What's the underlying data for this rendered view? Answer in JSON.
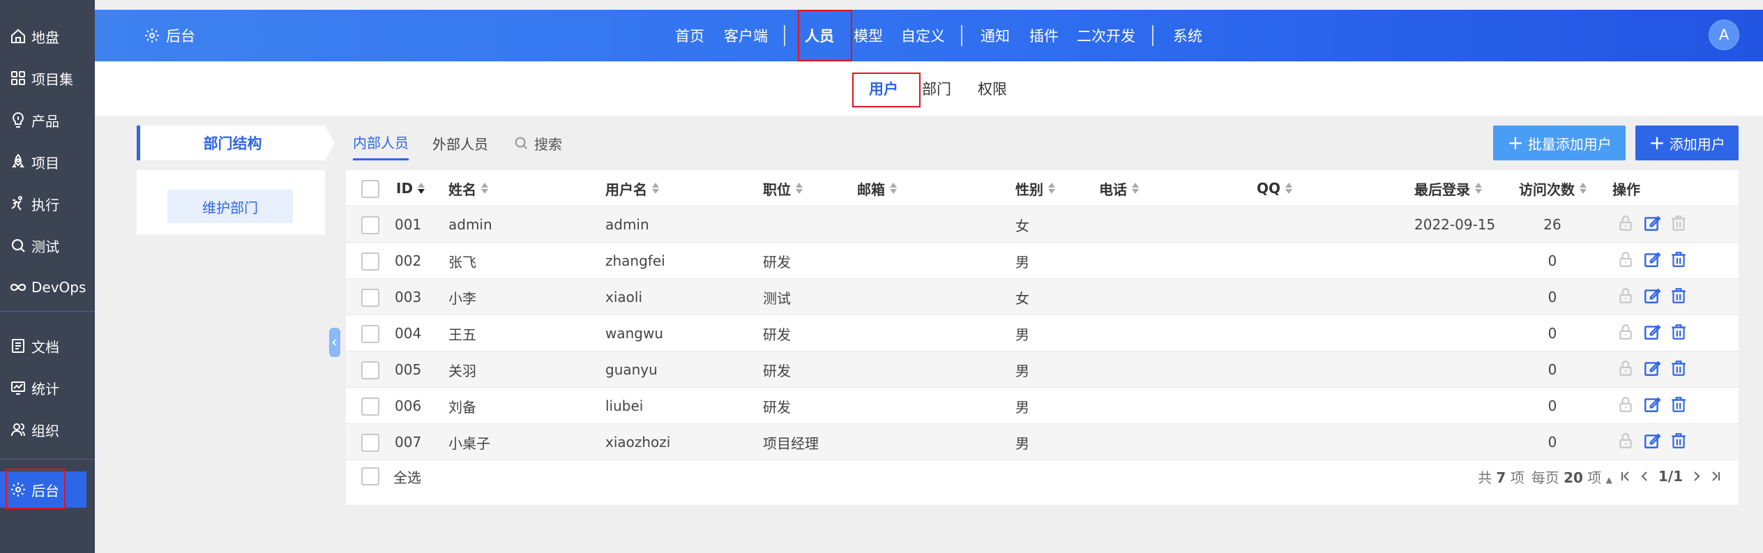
{
  "sidebar": {
    "items": [
      {
        "label": "地盘",
        "icon": "home-icon"
      },
      {
        "label": "项目集",
        "icon": "grid-icon"
      },
      {
        "label": "产品",
        "icon": "bulb-icon"
      },
      {
        "label": "项目",
        "icon": "rocket-icon"
      },
      {
        "label": "执行",
        "icon": "run-icon"
      },
      {
        "label": "测试",
        "icon": "search-icon"
      },
      {
        "label": "DevOps",
        "icon": "infinity-icon"
      },
      {
        "label": "文档",
        "icon": "doc-icon"
      },
      {
        "label": "统计",
        "icon": "chart-icon"
      },
      {
        "label": "组织",
        "icon": "people-icon"
      },
      {
        "label": "后台",
        "icon": "gear-icon",
        "active": true
      }
    ]
  },
  "header": {
    "brand": "后台",
    "nav": [
      "首页",
      "客户端",
      "人员",
      "模型",
      "自定义",
      "通知",
      "插件",
      "二次开发",
      "系统"
    ],
    "active_nav": "人员",
    "avatar_letter": "A"
  },
  "subnav": {
    "tabs": [
      "用户",
      "部门",
      "权限"
    ],
    "active": "用户"
  },
  "dept_panel": {
    "title": "部门结构",
    "maintain_button": "维护部门"
  },
  "user_tabs": {
    "internal": "内部人员",
    "external": "外部人员",
    "search": "搜索"
  },
  "actions": {
    "batch_add": "批量添加用户",
    "add": "添加用户"
  },
  "table": {
    "columns": {
      "id": "ID",
      "name": "姓名",
      "username": "用户名",
      "position": "职位",
      "email": "邮箱",
      "gender": "性别",
      "phone": "电话",
      "qq": "QQ",
      "last_login": "最后登录",
      "visits": "访问次数",
      "ops": "操作"
    },
    "rows": [
      {
        "id": "001",
        "name": "admin",
        "username": "admin",
        "position": "",
        "gender": "女",
        "last_login": "2022-09-15",
        "visits": "26"
      },
      {
        "id": "002",
        "name": "张飞",
        "username": "zhangfei",
        "position": "研发",
        "gender": "男",
        "last_login": "",
        "visits": "0"
      },
      {
        "id": "003",
        "name": "小李",
        "username": "xiaoli",
        "position": "测试",
        "gender": "女",
        "last_login": "",
        "visits": "0"
      },
      {
        "id": "004",
        "name": "王五",
        "username": "wangwu",
        "position": "研发",
        "gender": "男",
        "last_login": "",
        "visits": "0"
      },
      {
        "id": "005",
        "name": "关羽",
        "username": "guanyu",
        "position": "研发",
        "gender": "男",
        "last_login": "",
        "visits": "0"
      },
      {
        "id": "006",
        "name": "刘备",
        "username": "liubei",
        "position": "研发",
        "gender": "男",
        "last_login": "",
        "visits": "0"
      },
      {
        "id": "007",
        "name": "小桌子",
        "username": "xiaozhozi",
        "position": "项目经理",
        "gender": "男",
        "last_login": "",
        "visits": "0"
      }
    ],
    "select_all": "全选"
  },
  "pager": {
    "total_prefix": "共",
    "total": "7",
    "total_suffix": "项",
    "per_page_prefix": "每页",
    "per_page": "20",
    "per_page_suffix": "项",
    "page": "1/1"
  },
  "colors": {
    "sidebar_bg": "#3c4353",
    "accent": "#2e66e8",
    "header_gradient_start": "#3e82f0",
    "header_gradient_end": "#2254e2",
    "highlight_box": "#e0141e"
  }
}
